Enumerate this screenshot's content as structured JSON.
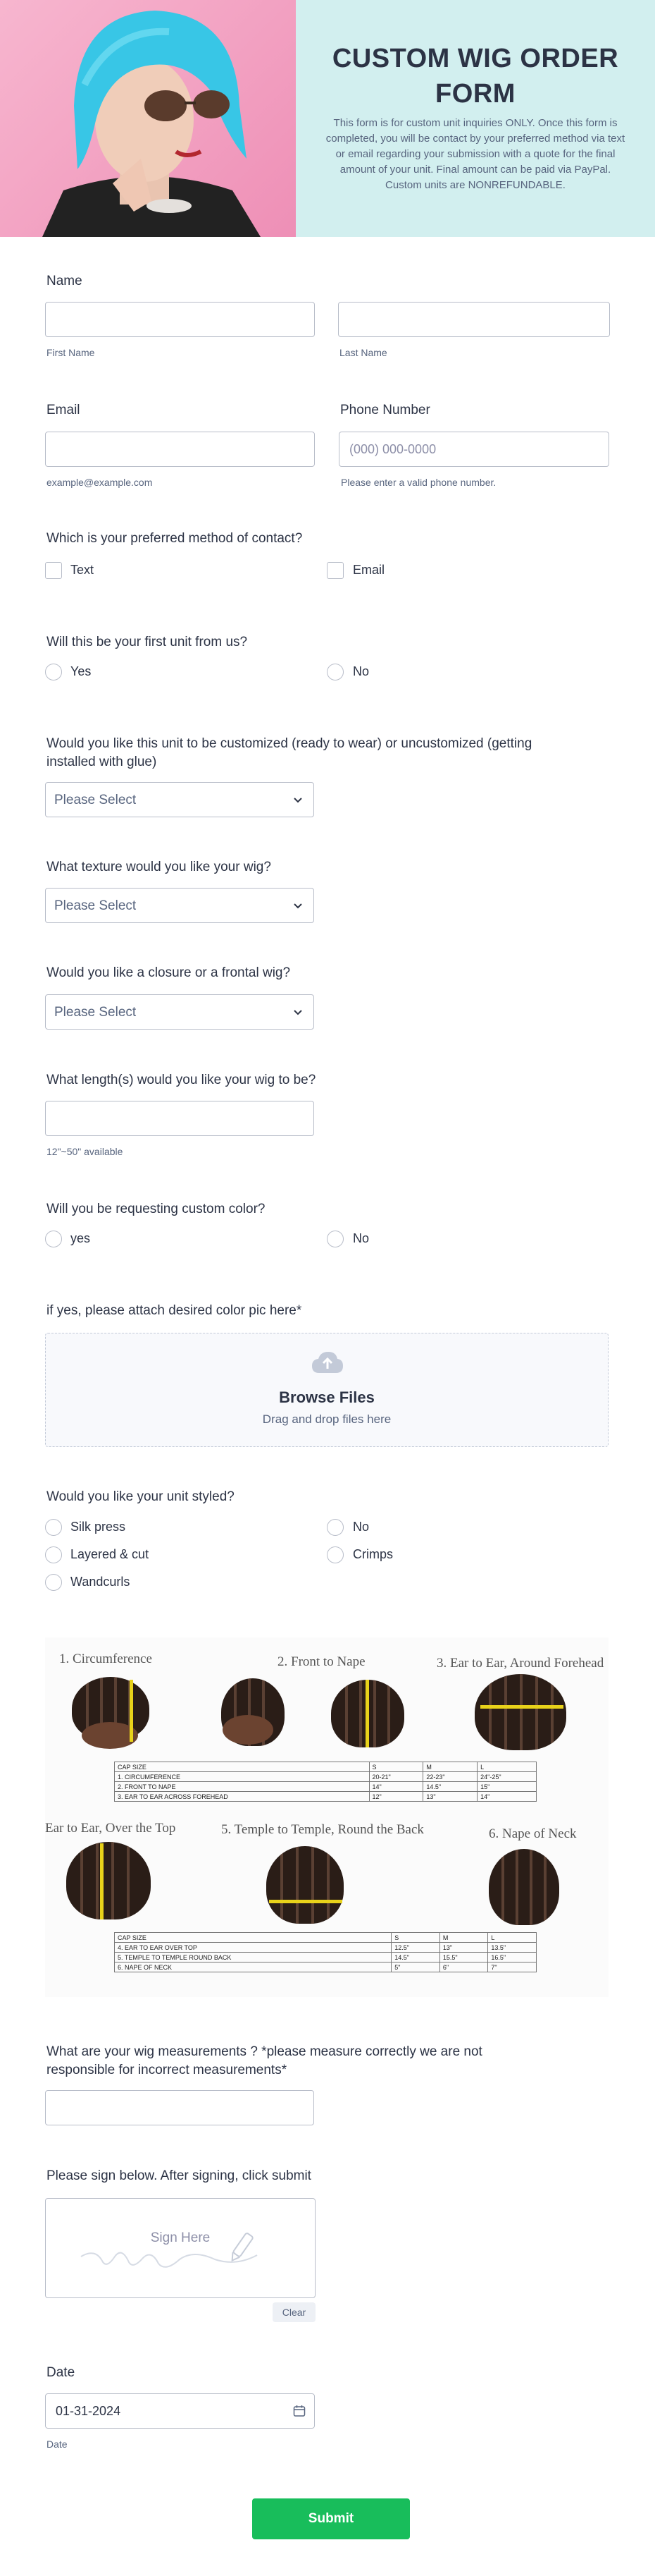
{
  "header": {
    "title_line1": "CUSTOM WIG ORDER",
    "title_line2": "FORM",
    "description": "This form is for custom unit inquiries ONLY. Once this form is completed, you will be contact by your preferred method via text or email regarding your submission with a quote for the final amount of your unit. Final amount can be paid via PayPal. Custom units are NONREFUNDABLE."
  },
  "name": {
    "label": "Name",
    "first_sub": "First Name",
    "last_sub": "Last Name",
    "first_value": "",
    "last_value": ""
  },
  "email": {
    "label": "Email",
    "sub": "example@example.com",
    "value": ""
  },
  "phone": {
    "label": "Phone Number",
    "placeholder": "(000) 000-0000",
    "sub": "Please enter a valid phone number."
  },
  "contact_method": {
    "label": "Which is your preferred method of contact?",
    "options": [
      "Text",
      "Email"
    ]
  },
  "first_unit": {
    "label": "Will this be your first unit from us?",
    "options": [
      "Yes",
      "No"
    ]
  },
  "customized": {
    "label_line1": "Would you like this unit to be customized (ready to wear) or uncustomized (getting",
    "label_line2": "installed with glue)",
    "placeholder": "Please Select"
  },
  "texture": {
    "label": "What texture would you like your wig?",
    "placeholder": "Please Select"
  },
  "closure": {
    "label": "Would you like a closure or a frontal wig?",
    "placeholder": "Please Select"
  },
  "length": {
    "label": "What length(s) would you like your wig to be?",
    "sub": "12\"~50\" available",
    "value": ""
  },
  "custom_color": {
    "label": "Will you be requesting custom color?",
    "options": [
      "yes",
      "No"
    ]
  },
  "color_upload": {
    "label": "if yes, please attach desired color pic here*",
    "browse": "Browse Files",
    "drop": "Drag and drop files here"
  },
  "styled": {
    "label": "Would you like your unit styled?",
    "options": [
      "Silk press",
      "No",
      "Layered & cut",
      "Crimps",
      "Wandcurls"
    ]
  },
  "measure_image": {
    "steps": [
      "1. Circumference",
      "2. Front to Nape",
      "3. Ear to Ear, Around Forehead",
      "Ear to Ear, Over the Top",
      "5. Temple to Temple, Round the Back",
      "6. Nape of Neck"
    ],
    "table1": {
      "header": [
        "CAP SIZE",
        "S",
        "M",
        "L"
      ],
      "rows": [
        [
          "1. CIRCUMFERENCE",
          "20-21\"",
          "22-23\"",
          "24\"-25\""
        ],
        [
          "2. FRONT TO NAPE",
          "14\"",
          "14.5\"",
          "15\""
        ],
        [
          "3. EAR TO EAR ACROSS FOREHEAD",
          "12\"",
          "13\"",
          "14\""
        ]
      ]
    },
    "table2": {
      "header": [
        "CAP SIZE",
        "S",
        "M",
        "L"
      ],
      "rows": [
        [
          "4. EAR TO EAR OVER TOP",
          "12.5\"",
          "13\"",
          "13.5\""
        ],
        [
          "5. TEMPLE TO TEMPLE ROUND BACK",
          "14.5\"",
          "15.5\"",
          "16.5\""
        ],
        [
          "6. NAPE OF NECK",
          "5\"",
          "6\"",
          "7\""
        ]
      ]
    }
  },
  "measurements": {
    "label_line1": "What are your wig measurements ? *please measure correctly we are not",
    "label_line2": "responsible for incorrect measurements*",
    "value": ""
  },
  "signature": {
    "label": "Please sign below. After signing, click submit",
    "placeholder": "Sign Here",
    "clear": "Clear"
  },
  "date": {
    "label": "Date",
    "value": "01-31-2024",
    "sub": "Date"
  },
  "submit": {
    "label": "Submit"
  },
  "colors": {
    "header_bg": "#d2efef",
    "submit": "#18bd5b",
    "text": "#2c3345",
    "sub_text": "#57647e",
    "border": "#b8bdc9"
  },
  "icons": {
    "calendar": "calendar-icon",
    "upload": "upload-cloud-icon",
    "chevron": "chevron-down-icon",
    "pen": "pen-icon"
  }
}
